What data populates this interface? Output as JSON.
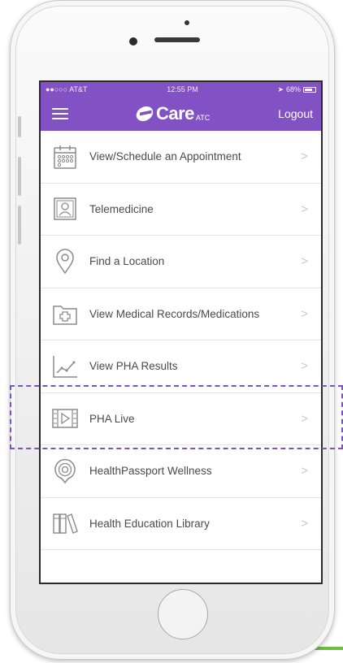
{
  "status_bar": {
    "carrier": "●●○○○ AT&T",
    "time": "12:55 PM",
    "battery": "68%"
  },
  "nav_bar": {
    "logo_text": "Care",
    "logo_suffix": "ATC",
    "logout_label": "Logout"
  },
  "menu": {
    "items": [
      {
        "label": "View/Schedule an Appointment",
        "icon": "calendar-icon"
      },
      {
        "label": "Telemedicine",
        "icon": "video-profile-icon"
      },
      {
        "label": "Find a Location",
        "icon": "location-pin-icon"
      },
      {
        "label": "View Medical Records/Medications",
        "icon": "medical-folder-icon"
      },
      {
        "label": "View PHA Results",
        "icon": "line-chart-icon"
      },
      {
        "label": "PHA Live",
        "icon": "film-play-icon",
        "highlighted": true
      },
      {
        "label": "HealthPassport Wellness",
        "icon": "target-rings-icon"
      },
      {
        "label": "Health Education Library",
        "icon": "books-icon"
      }
    ],
    "chevron": ">"
  },
  "colors": {
    "brand_purple": "#8251c3",
    "highlight_dashed": "#7a53c0",
    "accent_green": "#6cbf3f",
    "icon_gray": "#8a8a8a"
  }
}
